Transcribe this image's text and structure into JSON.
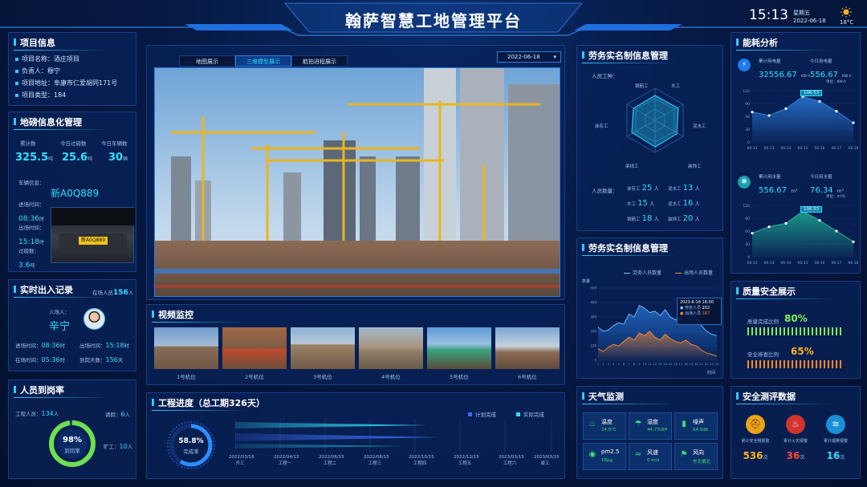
{
  "header": {
    "title": "翰萨智慧工地管理平台",
    "time": "15:13",
    "weekday": "星期五",
    "date": "2022-06-18",
    "temp": "18°C"
  },
  "project": {
    "title": "项目信息",
    "rows": [
      {
        "k": "项目名称：",
        "v": "酒庄项目"
      },
      {
        "k": "负责人：",
        "v": "穆宁"
      },
      {
        "k": "项目地址：",
        "v": "阜康市仁爱胡同171号"
      },
      {
        "k": "项目类型：",
        "v": "184"
      }
    ]
  },
  "scale": {
    "title": "地磅信息化管理",
    "stats": [
      {
        "label": "累计数",
        "value": "325.5",
        "unit": "吨"
      },
      {
        "label": "今日过磅数",
        "value": "25.6",
        "unit": "吨"
      },
      {
        "label": "今日车辆数",
        "value": "30",
        "unit": "辆"
      }
    ],
    "vehicle_label": "车辆信息：",
    "plate": "新A0Q889",
    "plate_img": "新A0Q889",
    "entry_label": "进场时间：",
    "entry": "08:36",
    "entry_unit": "时",
    "exit_label": "出场时间：",
    "exit": "15:18",
    "exit_unit": "时",
    "weight_label": "过磅数：",
    "weight": "3.6",
    "weight_unit": "吨"
  },
  "access": {
    "title": "实时出入记录",
    "inside_label": "在场人员",
    "inside": "156",
    "inside_unit": "人",
    "person_label": "入场人：",
    "person": "辛宁",
    "rows": [
      {
        "k": "进场时间：",
        "v": "08:36",
        "u": "时"
      },
      {
        "k": "出场时间：",
        "v": "15:18",
        "u": "时"
      },
      {
        "k": "在场时间：",
        "v": "05:36",
        "u": "时"
      },
      {
        "k": "到岗天数：",
        "v": "156",
        "u": "天"
      }
    ]
  },
  "onduty": {
    "title": "人员到岗率",
    "labels": [
      {
        "k": "工程人员：",
        "v": "134",
        "u": "人"
      },
      {
        "k": "请假：",
        "v": "6",
        "u": "人"
      },
      {
        "k": "旷工：",
        "v": "10",
        "u": "人"
      }
    ],
    "rate": "98%",
    "rate_label": "到岗率"
  },
  "center": {
    "tabs": [
      "地图展示",
      "三维模型展示",
      "航拍进程展示"
    ],
    "date": "2022-06-18"
  },
  "video": {
    "title": "视频监控",
    "cams": [
      "1号机位",
      "2号机位",
      "3号机位",
      "4号机位",
      "5号机位",
      "6号机位"
    ]
  },
  "progress": {
    "title": "工程进度（总工期326天）",
    "legend": [
      "计划完成",
      "实际完成"
    ],
    "pct": "58.8%",
    "pct_label": "完成率",
    "dates": [
      "2022/03/16",
      "2022/04/15",
      "2022/06/15",
      "2022/08/15",
      "2022/10/15",
      "2022/12/15",
      "2023/03/15",
      "2023/03/15"
    ],
    "stages": [
      "开工",
      "工程一",
      "工程二",
      "工程三",
      "工程四",
      "工程五",
      "工程六",
      "竣工"
    ]
  },
  "labor": {
    "title": "劳务实名制信息管理",
    "work_label": "人员工种：",
    "radar_axes": [
      "钢筋工",
      "木工",
      "泥水工",
      "装饰工",
      "架线工",
      "抹灰工"
    ],
    "count_label": "人员数量：",
    "counts": [
      {
        "k": "抹灰工",
        "v": "25"
      },
      {
        "k": "泥水工",
        "v": "13"
      },
      {
        "k": "木工",
        "v": "15"
      },
      {
        "k": "泥水工",
        "v": "16"
      },
      {
        "k": "钢筋工",
        "v": "18"
      },
      {
        "k": "装饰工",
        "v": "20"
      }
    ],
    "unit": "人"
  },
  "labor2": {
    "title": "劳务实名制信息管理",
    "legend": [
      "劳务人员数量",
      "出场人员数量"
    ],
    "ylabel": "数量",
    "xlabel": "时间",
    "tip_date": "2023-6-18 16:00",
    "tip_a_label": "劳务人员",
    "tip_a": "202",
    "tip_b_label": "出场人员",
    "tip_b": "187"
  },
  "weather": {
    "title": "天气监测",
    "items": [
      {
        "k": "温度",
        "v": "24.9℃"
      },
      {
        "k": "湿度",
        "v": "44.7%RH"
      },
      {
        "k": "噪声",
        "v": "64.5db"
      },
      {
        "k": "pm2.5",
        "v": "18μg"
      },
      {
        "k": "风速",
        "v": "0 m/s"
      },
      {
        "k": "风向",
        "v": "东北偏北"
      }
    ]
  },
  "energy": {
    "title": "能耗分析",
    "elec": {
      "total_label": "累计用电量",
      "total": "32556.67",
      "total_unit": "KW·h",
      "today_label": "今日用电量",
      "today": "556.67",
      "today_unit": "KW·h",
      "unit_tag": "单位：KW·h",
      "tip": "106.53"
    },
    "water": {
      "total_label": "累计用水量",
      "total": "556.67",
      "total_unit": "m³",
      "today_label": "今日用水量",
      "today": "76.34",
      "today_unit": "m³",
      "unit_tag": "单位：m³/h",
      "tip": "106.53"
    },
    "xlabels": [
      "06-12",
      "06-13",
      "06-14",
      "06-15",
      "06-16",
      "06-17",
      "06-18"
    ]
  },
  "quality": {
    "title": "质量安全展示",
    "rows": [
      {
        "k": "质量完成比例",
        "v": "80%"
      },
      {
        "k": "安全排查比例",
        "v": "65%"
      }
    ]
  },
  "safety": {
    "title": "安全测评数据",
    "items": [
      {
        "k": "累计安全帽报警",
        "v": "536",
        "u": "次"
      },
      {
        "k": "累计火灾报警",
        "v": "36",
        "u": "次"
      },
      {
        "k": "累计烟雾报警",
        "v": "16",
        "u": "次"
      }
    ]
  },
  "chart_data": [
    {
      "type": "area",
      "title": "",
      "categories": [
        "06-12",
        "06-13",
        "06-14",
        "06-15",
        "06-16",
        "06-17",
        "06-18"
      ],
      "series": [
        {
          "values": [
            70,
            62,
            78,
            106.53,
            95,
            72,
            45
          ]
        }
      ],
      "ylim": [
        0,
        120
      ]
    },
    {
      "type": "area",
      "title": "",
      "categories": [
        "06-12",
        "06-13",
        "06-14",
        "06-15",
        "06-16",
        "06-17",
        "06-18"
      ],
      "series": [
        {
          "values": [
            55,
            70,
            78,
            106.53,
            85,
            60,
            35
          ]
        }
      ],
      "ylim": [
        0,
        120
      ]
    },
    {
      "type": "line",
      "title": "",
      "categories": [
        "1",
        "2",
        "3",
        "4",
        "5",
        "6",
        "7",
        "8",
        "9",
        "10",
        "11",
        "12",
        "13",
        "14",
        "15",
        "16",
        "17",
        "18",
        "19",
        "20",
        "21",
        "22",
        "23",
        "24"
      ],
      "series": [
        {
          "name": "劳务人员数量",
          "values": [
            230,
            200,
            210,
            240,
            260,
            250,
            320,
            300,
            380,
            360,
            330,
            340,
            310,
            350,
            300,
            280,
            290,
            320,
            330,
            300,
            240,
            200,
            180,
            170
          ]
        },
        {
          "name": "出场人员数量",
          "values": [
            80,
            60,
            90,
            110,
            100,
            130,
            160,
            140,
            190,
            170,
            200,
            160,
            140,
            180,
            150,
            130,
            120,
            140,
            110,
            100,
            70,
            50,
            40,
            30
          ]
        }
      ],
      "ylim": [
        0,
        500
      ]
    }
  ]
}
